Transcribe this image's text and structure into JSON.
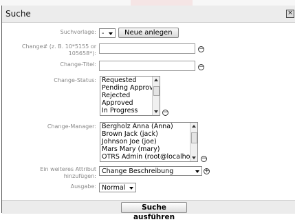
{
  "dialog": {
    "title": "Suche",
    "close_glyph": "×"
  },
  "form": {
    "template": {
      "label": "Suchvorlage:",
      "value": "-",
      "create_button": "Neue anlegen"
    },
    "change_number": {
      "label_line1": "Change# (z. B. 10*5155 or",
      "label_line2": "105658*):",
      "value": ""
    },
    "change_title": {
      "label": "Change-Titel:",
      "value": ""
    },
    "change_status": {
      "label": "Change-Status:",
      "options": [
        "Requested",
        "Pending Approval",
        "Rejected",
        "Approved",
        "In Progress"
      ]
    },
    "change_manager": {
      "label": "Change-Manager:",
      "options": [
        "Bergholz Anna (Anna)",
        "Brown Jack (jack)",
        "Johnson Joe (joe)",
        "Mars Mary (mary)",
        "OTRS Admin (root@localhost)"
      ]
    },
    "add_attribute": {
      "label_line1": "Ein weiteres Attribut",
      "label_line2": "hinzufügen:",
      "value": "Change Beschreibung"
    },
    "output": {
      "label": "Ausgabe:",
      "value": "Normal"
    }
  },
  "footer": {
    "submit_label": "Suche ausführen"
  },
  "icons": {
    "remove": "minus-circle-icon",
    "add": "plus-circle-icon"
  }
}
